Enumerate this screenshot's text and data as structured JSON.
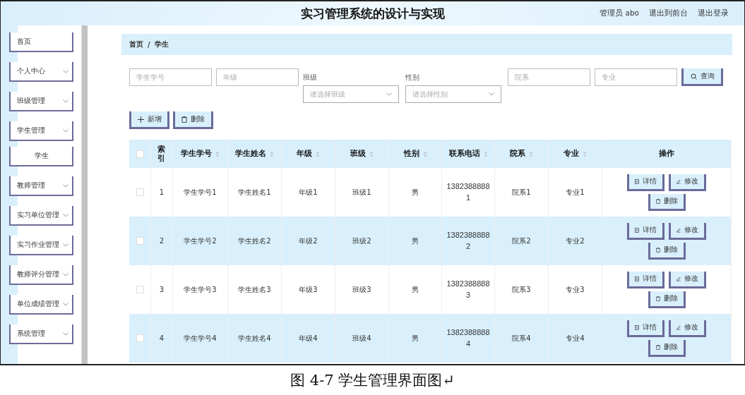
{
  "header": {
    "title": "实习管理系统的设计与实现",
    "user": "管理员 abo",
    "links": [
      "退出到前台",
      "退出登录"
    ]
  },
  "sidebar": {
    "items": [
      {
        "label": "首页",
        "kind": "link"
      },
      {
        "label": "个人中心",
        "kind": "menu"
      },
      {
        "label": "班级管理",
        "kind": "menu"
      },
      {
        "label": "学生管理",
        "kind": "menu",
        "children": [
          {
            "label": "学生"
          }
        ]
      },
      {
        "label": "教师管理",
        "kind": "menu"
      },
      {
        "label": "实习单位管理",
        "kind": "menu"
      },
      {
        "label": "实习作业管理",
        "kind": "menu"
      },
      {
        "label": "教师评分管理",
        "kind": "menu"
      },
      {
        "label": "单位成绩管理",
        "kind": "menu"
      },
      {
        "label": "系统管理",
        "kind": "menu"
      }
    ]
  },
  "breadcrumb": {
    "items": [
      "首页",
      "学生"
    ],
    "separator": "/"
  },
  "search": {
    "fields": [
      {
        "kind": "input",
        "placeholder": "学生学号"
      },
      {
        "kind": "input",
        "placeholder": "年级"
      },
      {
        "kind": "select",
        "label": "班级",
        "placeholder": "请选择班级"
      },
      {
        "kind": "select",
        "label": "性别",
        "placeholder": "请选择性别"
      },
      {
        "kind": "input",
        "placeholder": "院系"
      },
      {
        "kind": "input",
        "placeholder": "专业"
      }
    ],
    "button": "查询"
  },
  "actions": [
    {
      "kind": "add",
      "label": "新增"
    },
    {
      "kind": "delete",
      "label": "删除"
    }
  ],
  "table": {
    "select_all": {
      "checked": false
    },
    "columns": [
      {
        "label": "索引",
        "sortable": false
      },
      {
        "label": "学生学号",
        "sortable": true
      },
      {
        "label": "学生姓名",
        "sortable": true
      },
      {
        "label": "年级",
        "sortable": true
      },
      {
        "label": "班级",
        "sortable": true
      },
      {
        "label": "性别",
        "sortable": true
      },
      {
        "label": "联系电话",
        "sortable": true
      },
      {
        "label": "院系",
        "sortable": true
      },
      {
        "label": "专业",
        "sortable": true
      },
      {
        "label": "操作",
        "sortable": false
      }
    ],
    "rows": [
      {
        "checked": false,
        "cells": [
          "1",
          "学生学号1",
          "学生姓名1",
          "年级1",
          "班级1",
          "男",
          "13823888881",
          "院系1",
          "专业1"
        ],
        "buttons": [
          {
            "kind": "detail",
            "label": "详情"
          },
          {
            "kind": "edit",
            "label": "修改"
          },
          {
            "kind": "delete",
            "label": "删除"
          }
        ]
      },
      {
        "checked": false,
        "cells": [
          "2",
          "学生学号2",
          "学生姓名2",
          "年级2",
          "班级2",
          "男",
          "13823888882",
          "院系2",
          "专业2"
        ],
        "buttons": [
          {
            "kind": "detail",
            "label": "详情"
          },
          {
            "kind": "edit",
            "label": "修改"
          },
          {
            "kind": "delete",
            "label": "删除"
          }
        ]
      },
      {
        "checked": false,
        "cells": [
          "3",
          "学生学号3",
          "学生姓名3",
          "年级3",
          "班级3",
          "男",
          "13823888883",
          "院系3",
          "专业3"
        ],
        "buttons": [
          {
            "kind": "detail",
            "label": "详情"
          },
          {
            "kind": "edit",
            "label": "修改"
          },
          {
            "kind": "delete",
            "label": "删除"
          }
        ]
      },
      {
        "checked": false,
        "cells": [
          "4",
          "学生学号4",
          "学生姓名4",
          "年级4",
          "班级4",
          "男",
          "13823888884",
          "院系4",
          "专业4"
        ],
        "buttons": [
          {
            "kind": "detail",
            "label": "详情"
          },
          {
            "kind": "edit",
            "label": "修改"
          },
          {
            "kind": "delete",
            "label": "删除"
          }
        ]
      }
    ]
  },
  "caption": "图 4-7 学生管理界面图↵"
}
